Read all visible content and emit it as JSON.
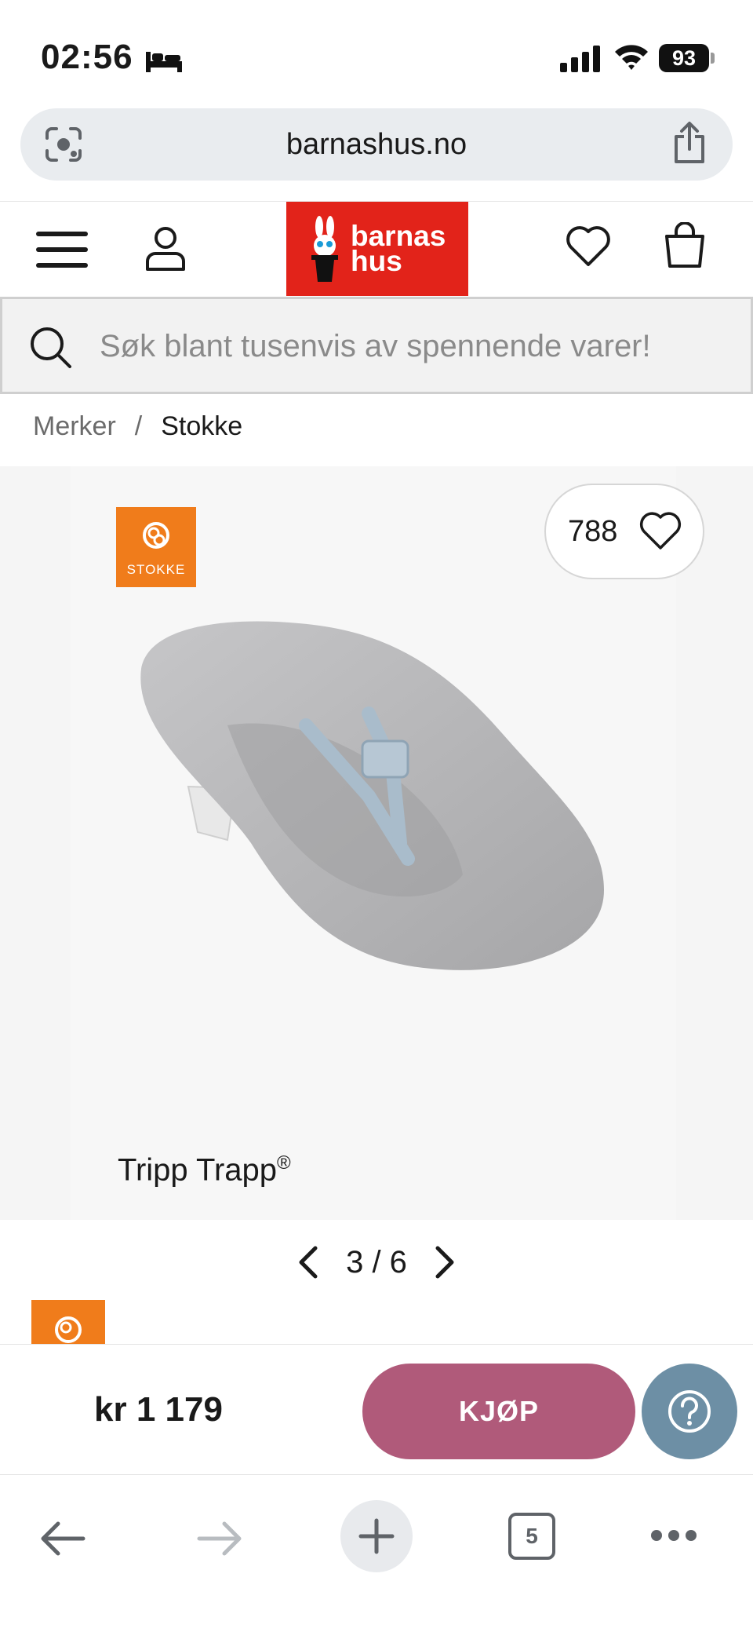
{
  "status_bar": {
    "time": "02:56",
    "battery": "93"
  },
  "browser": {
    "url": "barnashus.no",
    "open_tabs": "5"
  },
  "header": {
    "logo_line1": "barnas",
    "logo_line2": "hus",
    "brand_color": "#e2231a"
  },
  "search": {
    "placeholder": "Søk blant tusenvis av spennende varer!"
  },
  "breadcrumb": {
    "items": [
      "Merker",
      "Stokke"
    ],
    "separator": "/"
  },
  "product": {
    "brand_badge": "STOKKE",
    "favorite_count": "788",
    "image_caption": "Tripp Trapp",
    "caption_mark": "®",
    "pager": "3 / 6",
    "price": "kr 1 179",
    "buy_label": "KJØP"
  },
  "colors": {
    "buy_button": "#b05a7a",
    "help_button": "#6d8fa5",
    "stokke_orange": "#f07c1b"
  }
}
